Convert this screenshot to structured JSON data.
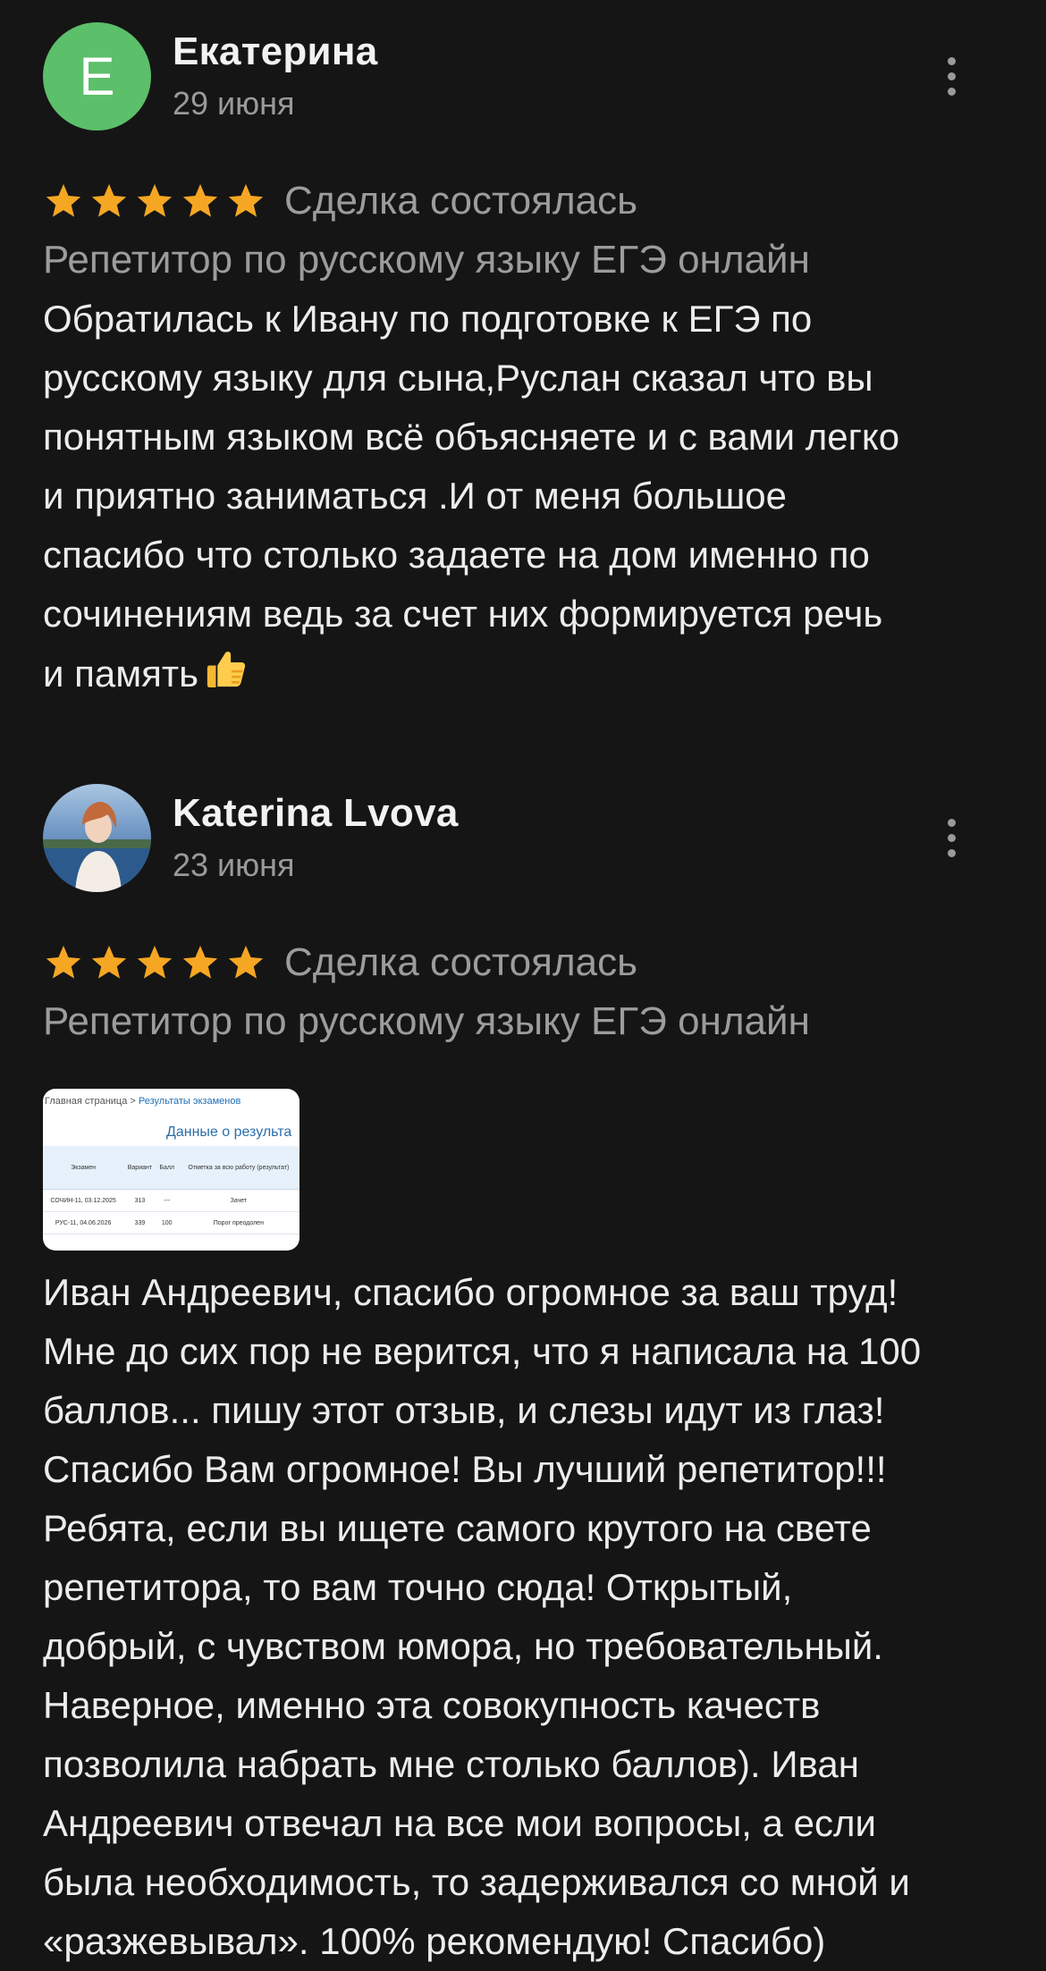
{
  "reviews": [
    {
      "author": "Екатерина",
      "avatar_letter": "Е",
      "date": "29 июня",
      "rating": 5,
      "deal_status": "Сделка состоялась",
      "service": "Репетитор по русскому языку ЕГЭ онлайн",
      "text": "Обратилась к Ивану по подготовке к ЕГЭ по\nрусскому языку для сына,Руслан сказал что вы\nпонятным языком всё объясняете и с вами легко\nи приятно заниматься .И от меня большое\nспасибо что столько задаете на дом именно по\nсочинениям ведь за счет них формируется речь\nи память",
      "emoji": "thumbs-up"
    },
    {
      "author": "Katerina Lvova",
      "date": "23 июня",
      "rating": 5,
      "deal_status": "Сделка состоялась",
      "service": "Репетитор по русскому языку ЕГЭ онлайн",
      "attachment": {
        "crumb_home": "Главная страница >",
        "crumb_link": "Результаты экзаменов",
        "title": "Данные о результа",
        "headers": [
          "Экзамен",
          "Вариант",
          "Балл",
          "Отметка за всю работу (результат)"
        ],
        "rows": [
          [
            "СОЧИН-11, 03.12.2025",
            "313",
            "---",
            "Зачет"
          ],
          [
            "РУС-11, 04.06.2026",
            "339",
            "100",
            "Порог преодолен"
          ]
        ]
      },
      "text": "Иван Андреевич, спасибо огромное за ваш труд!\nМне до сих пор не верится, что я написала на 100\nбаллов... пишу этот отзыв, и слезы идут из глаз!\nСпасибо Вам огромное! Вы лучший репетитор!!!\nРебята, если вы ищете самого крутого на свете\nрепетитора, то вам точно сюда! Открытый,\nдобрый, с чувством юмора, но требовательный.\nНаверное, именно эта совокупность качеств\nпозволила набрать мне столько баллов). Иван\nАндреевич отвечал на все мои вопросы, а если\nбыла необходимость, то задерживался со мной и\n«разжевывал». 100% рекомендую! Спасибо)"
    }
  ],
  "colors": {
    "background": "#151515",
    "star": "#f5a623",
    "avatar_green": "#5cbf6a",
    "muted_text": "#9c9c9c"
  },
  "icons": [
    "star-icon",
    "more-vertical-icon",
    "thumbs-up-icon"
  ]
}
